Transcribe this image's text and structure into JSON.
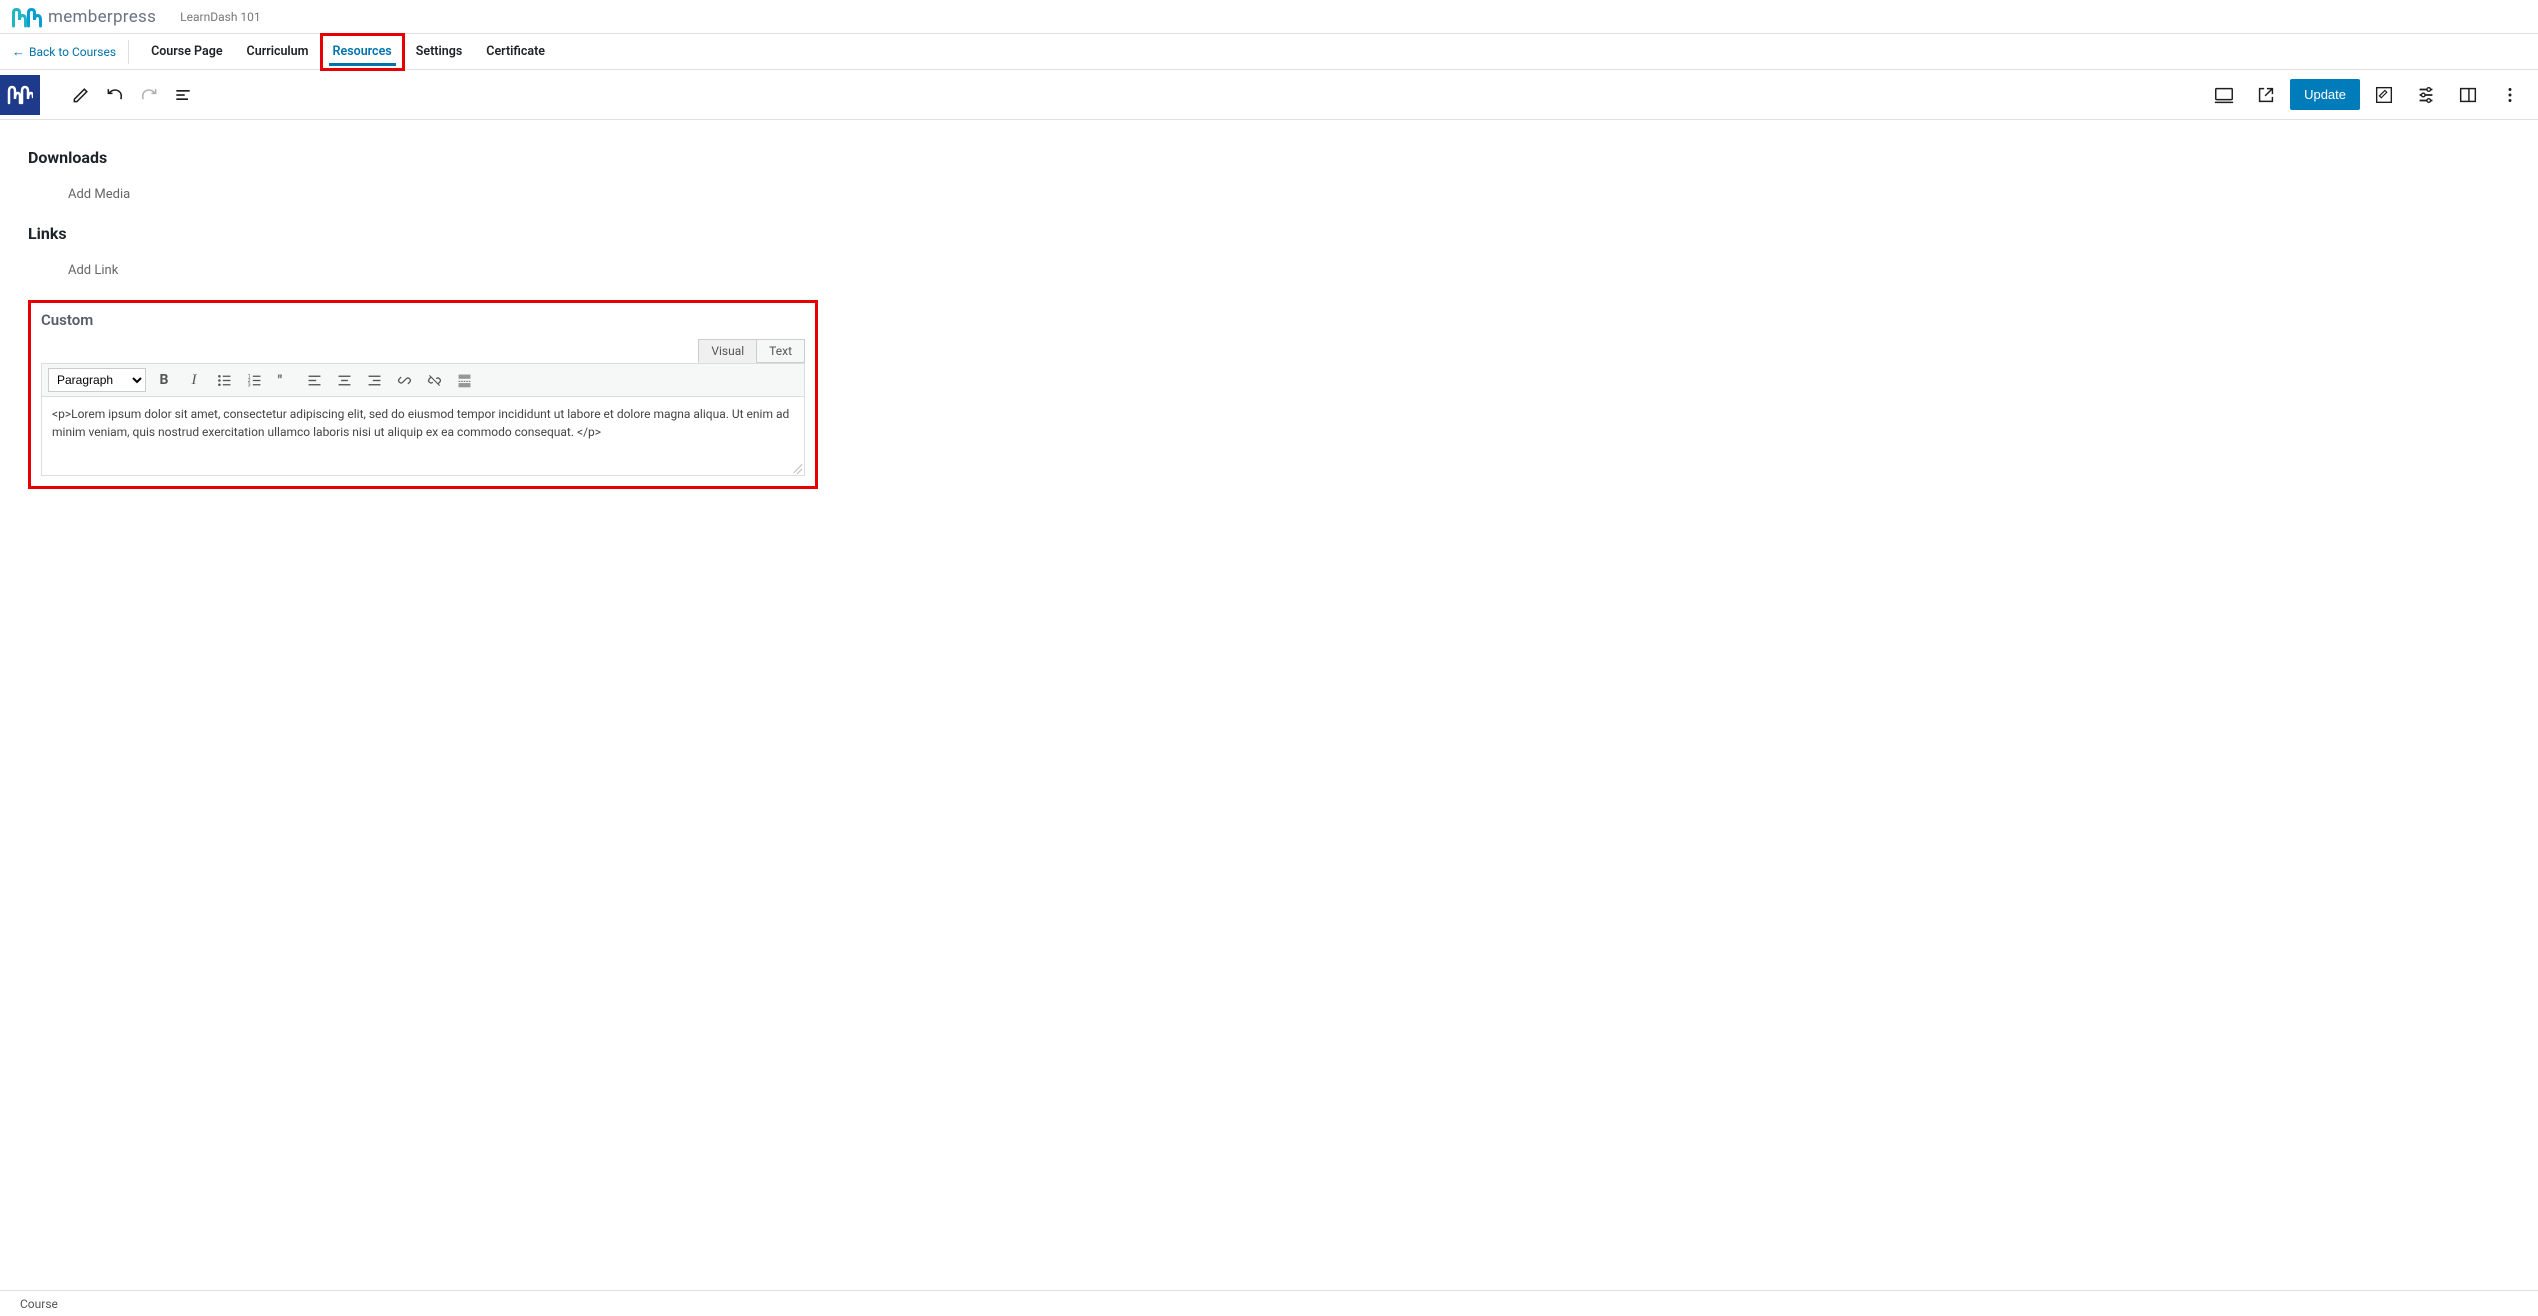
{
  "header": {
    "brand_text": "memberpress",
    "breadcrumb": "LearnDash 101"
  },
  "nav": {
    "back_label": "Back to Courses",
    "tabs": [
      "Course Page",
      "Curriculum",
      "Resources",
      "Settings",
      "Certificate"
    ],
    "active_index": 2
  },
  "toolbar": {
    "update_label": "Update"
  },
  "sections": {
    "downloads": {
      "heading": "Downloads",
      "action": "Add Media"
    },
    "links": {
      "heading": "Links",
      "action": "Add Link"
    },
    "custom": {
      "heading": "Custom",
      "tabs": {
        "visual": "Visual",
        "text": "Text"
      },
      "paragraph_option": "Paragraph",
      "content": "<p>Lorem ipsum dolor sit amet, consectetur adipiscing elit, sed do eiusmod tempor incididunt ut labore et dolore magna aliqua. Ut enim ad minim veniam, quis nostrud exercitation ullamco laboris nisi ut aliquip ex ea commodo consequat. </p>"
    }
  },
  "footer": {
    "text": "Course"
  }
}
